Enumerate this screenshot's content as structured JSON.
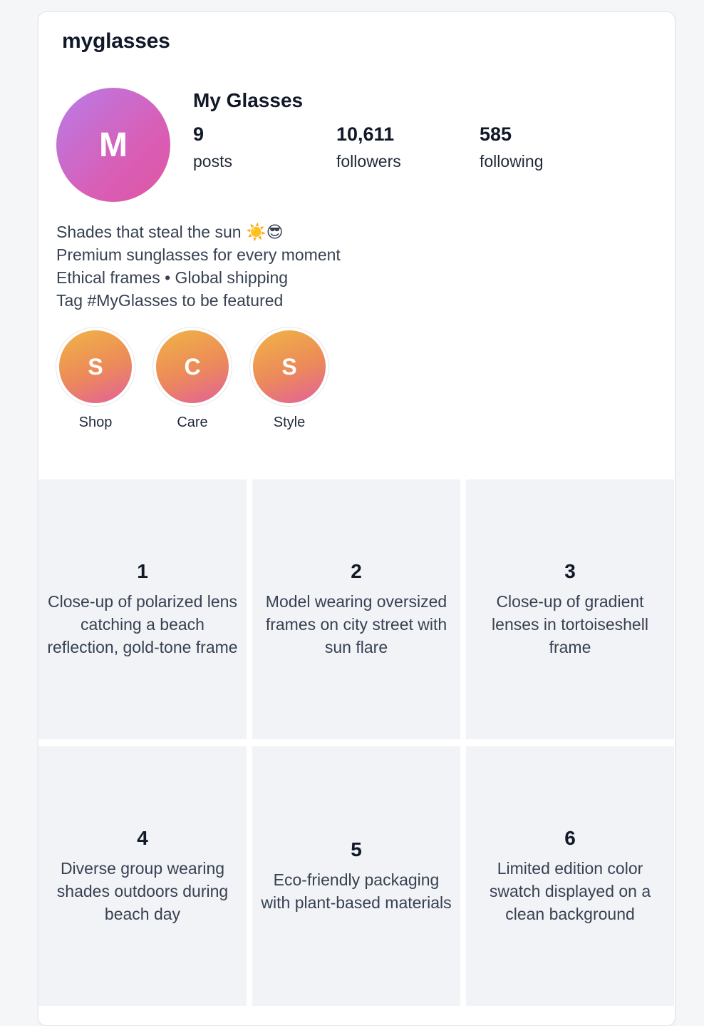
{
  "profile": {
    "username": "myglasses",
    "display_name": "My Glasses",
    "avatar_initial": "M",
    "stats": {
      "posts_value": "9",
      "posts_label": "posts",
      "followers_value": "10,611",
      "followers_label": "followers",
      "following_value": "585",
      "following_label": "following"
    },
    "bio": [
      "Shades that steal the sun ☀️😎",
      "Premium sunglasses for every moment",
      "Ethical frames • Global shipping",
      "Tag #MyGlasses to be featured"
    ]
  },
  "highlights": [
    {
      "initial": "S",
      "label": "Shop"
    },
    {
      "initial": "C",
      "label": "Care"
    },
    {
      "initial": "S",
      "label": "Style"
    }
  ],
  "posts": [
    {
      "number": "1",
      "caption": "Close-up of polarized lens catching a beach reflection, gold-tone frame"
    },
    {
      "number": "2",
      "caption": "Model wearing oversized frames on city street with sun flare"
    },
    {
      "number": "3",
      "caption": "Close-up of gradient lenses in tortoiseshell frame"
    },
    {
      "number": "4",
      "caption": "Diverse group wearing shades outdoors during beach day"
    },
    {
      "number": "5",
      "caption": "Eco-friendly packaging with plant-based materials"
    },
    {
      "number": "6",
      "caption": "Limited edition color swatch displayed on a clean background"
    }
  ],
  "colors": {
    "avatar_gradient": [
      "#b87ce8",
      "#de55a2"
    ],
    "highlight_gradient": [
      "#f0b445",
      "#e2609a"
    ],
    "tile_background": "#f1f3f7"
  }
}
